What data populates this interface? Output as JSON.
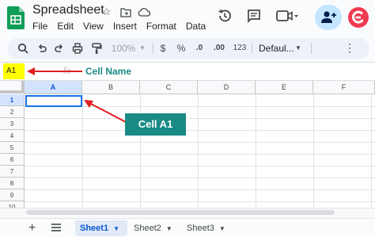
{
  "app": {
    "title": "Spreadsheet",
    "menu": [
      "File",
      "Edit",
      "View",
      "Insert",
      "Format",
      "Data"
    ]
  },
  "toolbar": {
    "zoom": "100%",
    "currency": "$",
    "percent": "%",
    "decrease_decimal": ".0",
    "increase_decimal": ".00",
    "number_format": "123",
    "font": "Defaul..."
  },
  "formula_bar": {
    "name_box": "A1",
    "fx": "fx",
    "annotation": "Cell Name"
  },
  "grid": {
    "columns": [
      "A",
      "B",
      "C",
      "D",
      "E",
      "F"
    ],
    "rows": [
      "1",
      "2",
      "3",
      "4",
      "5",
      "6",
      "7",
      "8",
      "9",
      "10"
    ],
    "selected_cell": "A1"
  },
  "callout": {
    "label": "Cell A1"
  },
  "sheets": {
    "add": "+",
    "tabs": [
      "Sheet1",
      "Sheet2",
      "Sheet3"
    ],
    "active": "Sheet1"
  },
  "colors": {
    "annotation": "#1a8a85",
    "arrow": "#e02020",
    "name_box_highlight": "#ffff00",
    "selection": "#1a73e8"
  }
}
